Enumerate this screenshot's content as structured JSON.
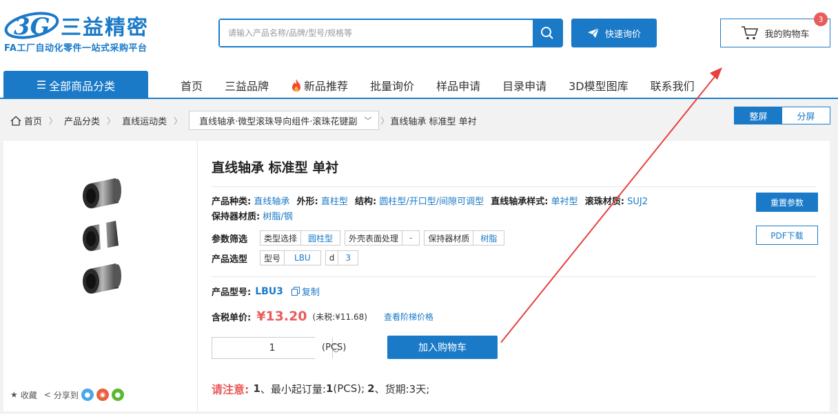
{
  "header": {
    "brand_name": "三益精密",
    "logo_mark_text": "3G",
    "tagline": "FA工厂自动化零件一站式采购平台",
    "search_placeholder": "请输入产品名称/品牌/型号/规格等",
    "quick_inquiry_label": "快速询价",
    "cart_label": "我的购物车",
    "cart_count": "3"
  },
  "nav": {
    "category_label": "全部商品分类",
    "items": [
      "首页",
      "三益品牌",
      "新品推荐",
      "批量询价",
      "样品申请",
      "目录申请",
      "3D模型图库",
      "联系我们"
    ]
  },
  "breadcrumb": {
    "home": "首页",
    "level1": "产品分类",
    "level2": "直线运动类",
    "level3": "直线轴承·微型滚珠导向组件·滚珠花键副",
    "current": "直线轴承 标准型 单衬"
  },
  "view_toggle": {
    "full": "整屏",
    "split": "分屏"
  },
  "product": {
    "title": "直线轴承 标准型 单衬",
    "specs": [
      {
        "label": "产品种类:",
        "value": "直线轴承"
      },
      {
        "label": "外形:",
        "value": "直柱型"
      },
      {
        "label": "结构:",
        "value": "圆柱型/开口型/间隙可调型"
      },
      {
        "label": "直线轴承样式:",
        "value": "单衬型"
      },
      {
        "label": "滚珠材质:",
        "value": "SUJ2"
      }
    ],
    "spec_row2": {
      "label": "保持器材质:",
      "value": "树脂/钢"
    },
    "filter_label": "参数筛选",
    "filters": [
      {
        "key": "类型选择",
        "value": "圆柱型"
      },
      {
        "key": "外壳表面处理",
        "value": "-"
      },
      {
        "key": "保持器材质",
        "value": "树脂"
      }
    ],
    "select_label": "产品选型",
    "selects": [
      {
        "key": "型号",
        "value": "LBU"
      },
      {
        "key": "d",
        "value": "3"
      }
    ],
    "reset_label": "重置参数",
    "pdf_label": "PDF下载",
    "model_label": "产品型号:",
    "model_value": "LBU3",
    "copy_label": "复制",
    "price_label": "含税单价:",
    "price_value": "¥13.20",
    "price_notax": "(未税:¥11.68)",
    "tier_price_label": "查看阶梯价格",
    "quantity": "1",
    "unit": "(PCS)",
    "add_to_cart": "加入购物车",
    "notice_label": "请注意:",
    "notice_n1": "1",
    "notice_t1": "、最小起订量:",
    "notice_moq": "1",
    "notice_t2": " (PCS);",
    "notice_n2": "2",
    "notice_t3": "、货期:3天;"
  },
  "share": {
    "favorite": "收藏",
    "share_to": "分享到"
  },
  "colors": {
    "primary": "#1a7ac8",
    "price": "#e85c5c",
    "annotation_arrow": "#e84040"
  }
}
